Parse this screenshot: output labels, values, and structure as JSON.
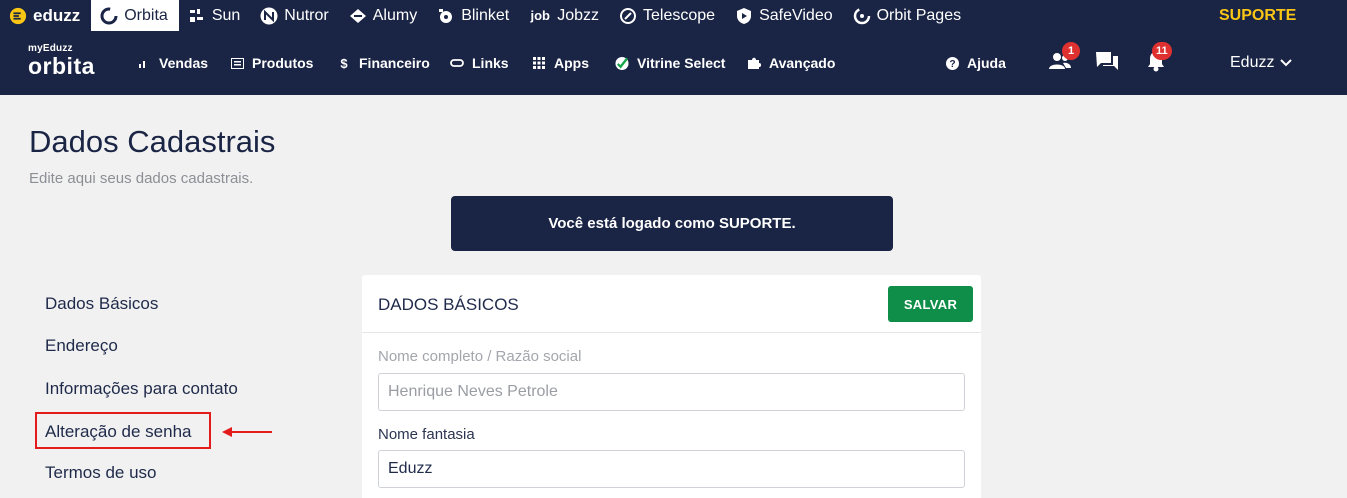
{
  "top_bar": {
    "products": [
      {
        "label": "eduzz",
        "icon": "eduzz-logo-icon"
      },
      {
        "label": "Orbita",
        "icon": "orbita-icon",
        "active": true
      },
      {
        "label": "Sun",
        "icon": "sun-icon"
      },
      {
        "label": "Nutror",
        "icon": "nutror-icon"
      },
      {
        "label": "Alumy",
        "icon": "alumy-icon"
      },
      {
        "label": "Blinket",
        "icon": "blinket-icon"
      },
      {
        "label": "Jobzz",
        "icon": "jobzz-icon"
      },
      {
        "label": "Telescope",
        "icon": "telescope-icon"
      },
      {
        "label": "SafeVideo",
        "icon": "safevideo-icon"
      },
      {
        "label": "Orbit Pages",
        "icon": "orbit-pages-icon"
      }
    ],
    "support_label": "SUPORTE"
  },
  "main_nav": {
    "logo_small": "myEduzz",
    "logo_big": "orbita",
    "items": [
      {
        "label": "Vendas",
        "icon": "bar-chart-icon"
      },
      {
        "label": "Produtos",
        "icon": "list-icon"
      },
      {
        "label": "Financeiro",
        "icon": "dollar-icon"
      },
      {
        "label": "Links",
        "icon": "link-icon"
      },
      {
        "label": "Apps",
        "icon": "grid-icon"
      },
      {
        "label": "Vitrine Select",
        "icon": "check-badge-icon"
      },
      {
        "label": "Avançado",
        "icon": "puzzle-icon"
      }
    ],
    "help_label": "Ajuda",
    "users_badge": "1",
    "notifications_badge": "11",
    "user_name": "Eduzz"
  },
  "page": {
    "title": "Dados Cadastrais",
    "subtitle": "Edite aqui seus dados cadastrais.",
    "alert": "Você está logado como SUPORTE."
  },
  "side_menu": {
    "items": [
      "Dados Básicos",
      "Endereço",
      "Informações para contato",
      "Alteração de senha",
      "Termos de uso"
    ]
  },
  "form": {
    "title": "DADOS BÁSICOS",
    "save_label": "SALVAR",
    "full_name_label": "Nome completo / Razão social",
    "full_name_value": "Henrique Neves Petrole",
    "fantasy_name_label": "Nome fantasia",
    "fantasy_name_value": "Eduzz"
  },
  "colors": {
    "nav_bg": "#1a2444",
    "accent_yellow": "#f9c616",
    "save_green": "#0e8e49",
    "highlight_red": "#e31b1b",
    "badge_red": "#e03131"
  }
}
